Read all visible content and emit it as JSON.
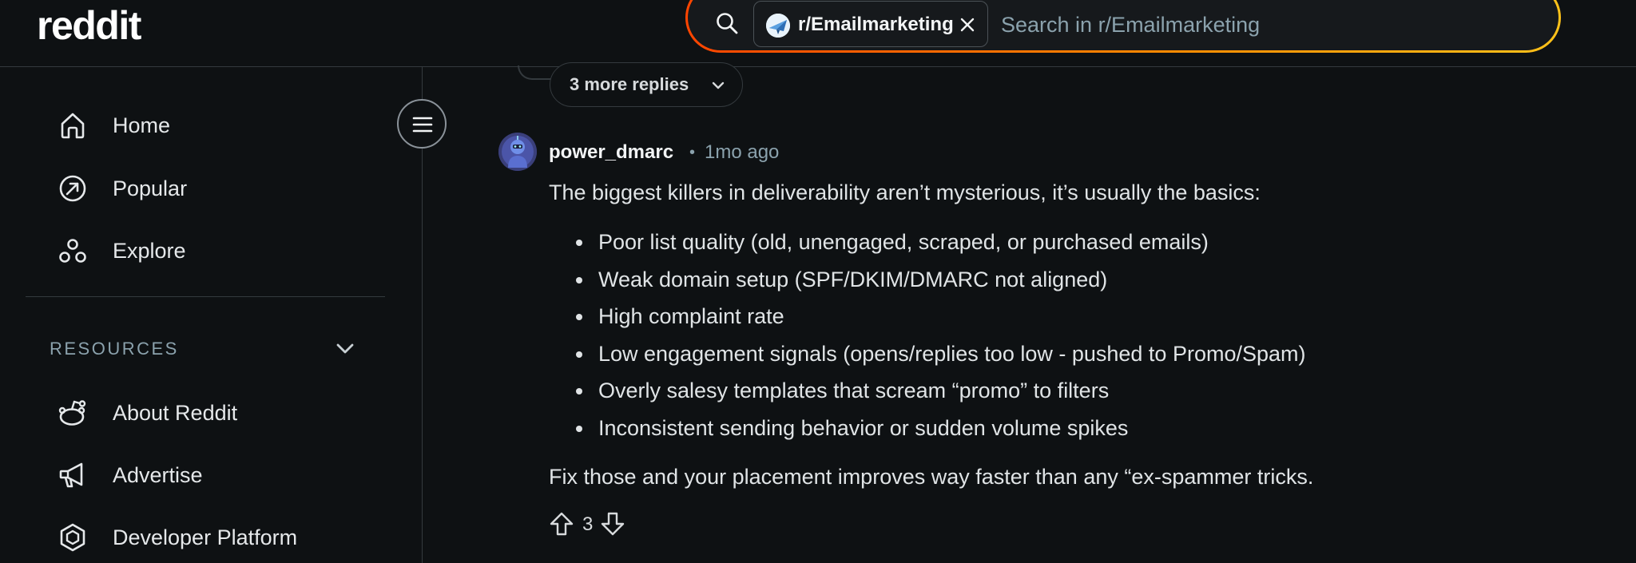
{
  "header": {
    "logo_text": "reddit",
    "search": {
      "icon": "search-icon",
      "community_chip_label": "r/Emailmarketing",
      "placeholder": "Search in r/Emailmarketing",
      "gradient_colors": [
        "#ff4500",
        "#ff8a00",
        "#ffc21a"
      ]
    }
  },
  "sidebar": {
    "nav_items": [
      {
        "label": "Home",
        "icon": "home-icon"
      },
      {
        "label": "Popular",
        "icon": "popular-arrow-icon"
      },
      {
        "label": "Explore",
        "icon": "explore-icon"
      }
    ],
    "resources_heading": "RESOURCES",
    "resources_items": [
      {
        "label": "About Reddit",
        "icon": "reddit-alien-icon"
      },
      {
        "label": "Advertise",
        "icon": "megaphone-icon"
      },
      {
        "label": "Developer Platform",
        "icon": "developer-hexagon-icon"
      }
    ],
    "menu_toggle_icon": "hamburger-menu-icon"
  },
  "thread": {
    "more_replies_label": "3 more replies",
    "comment": {
      "author": "power_dmarc",
      "separator": "•",
      "time_ago": "1mo ago",
      "intro": "The biggest killers in deliverability aren’t mysterious, it’s usually the basics:",
      "bullets": [
        "Poor list quality (old, unengaged, scraped, or purchased emails)",
        "Weak domain setup (SPF/DKIM/DMARC not aligned)",
        "High complaint rate",
        "Low engagement signals (opens/replies too low - pushed to Promo/Spam)",
        "Overly salesy templates that scream “promo” to filters",
        "Inconsistent sending behavior or sudden volume spikes"
      ],
      "outro": "Fix those and your placement improves way faster than any “ex-spammer tricks.",
      "vote_count": "3"
    }
  },
  "colors": {
    "background": "#0e1113",
    "divider": "#343a3e",
    "text_primary": "#e0e4e6",
    "text_muted": "#8ba2ad"
  }
}
